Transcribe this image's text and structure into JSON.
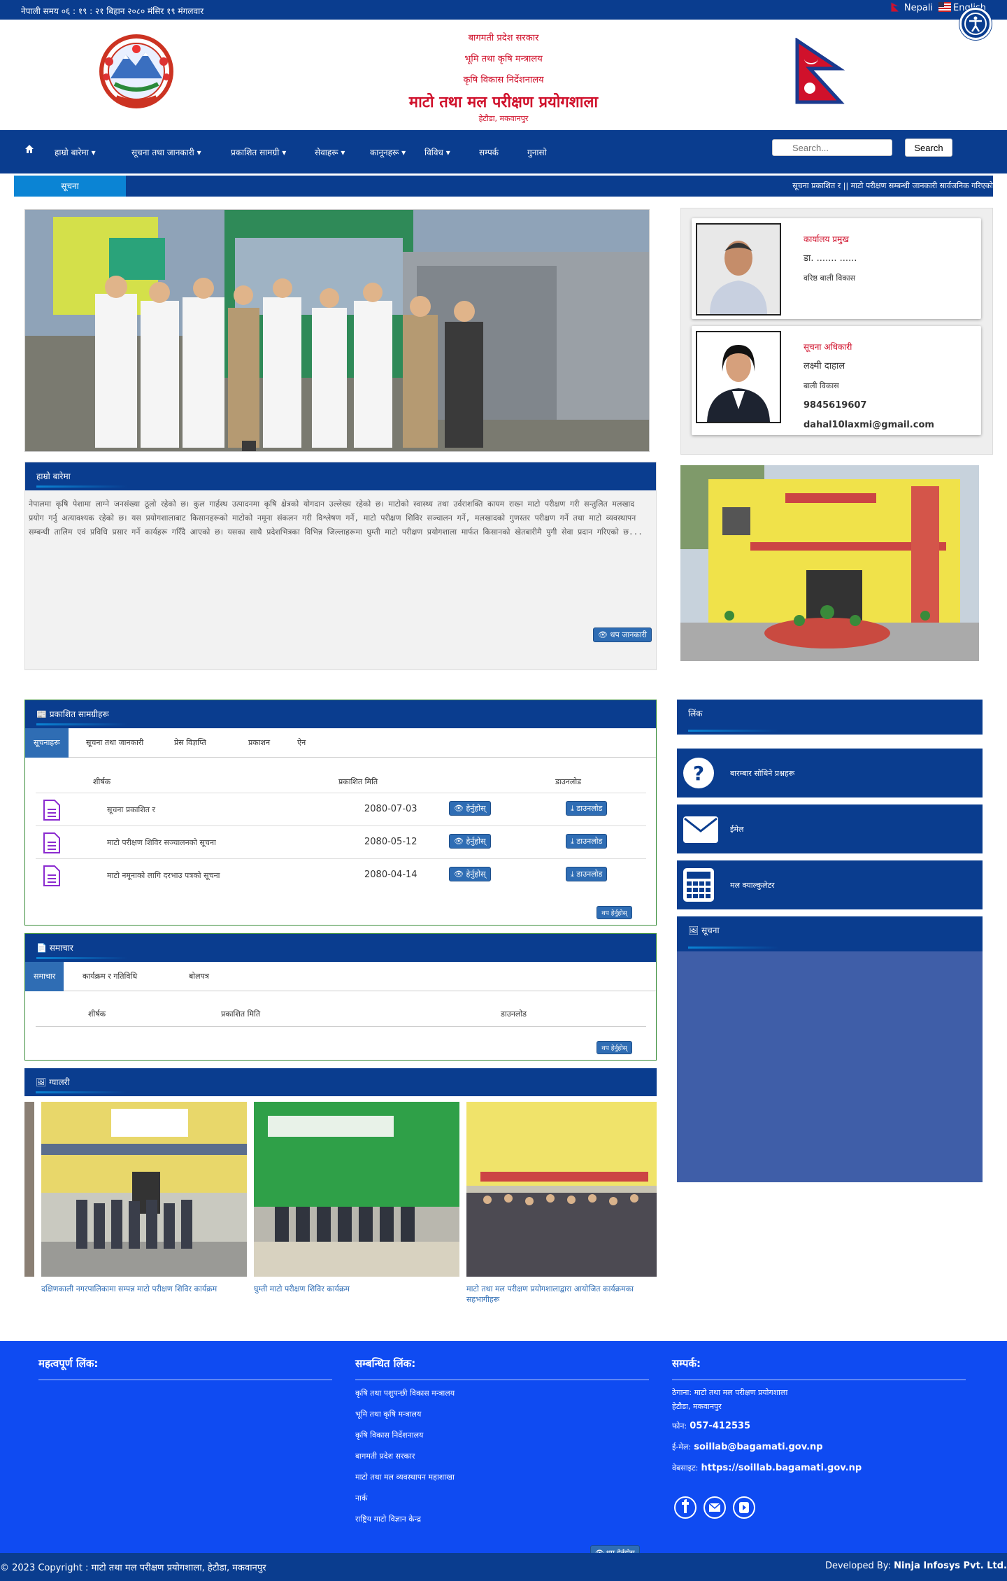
{
  "topbar": {
    "date_time": "नेपाली समय ०६ : १९ : २१ बिहान    २०८० मंसिर १९ मंगलवार",
    "lang_nepali": "Nepali",
    "lang_english": "English"
  },
  "header": {
    "line1": "बागमती प्रदेश सरकार",
    "line2": "भूमि तथा कृषि मन्त्रालय",
    "line3": "कृषि विकास निर्देशनालय",
    "title": "माटो तथा मल परीक्षण प्रयोगशाला",
    "subtitle": "हेटौडा, मकवानपुर"
  },
  "nav": {
    "items": [
      "हाम्रो बारेमा",
      "सूचना तथा जानकारी",
      "प्रकाशित सामग्री",
      "सेवाहरू",
      "कानूनहरू",
      "विविध",
      "सम्पर्क",
      "गुनासो"
    ],
    "search_placeholder": "Search...",
    "search_button": "Search"
  },
  "ticker": {
    "label": "सूचना",
    "message": "सूचना प्रकाशित र   || माटो परीक्षण सम्बन्धी जानकारी सार्वजनिक गरिएको"
  },
  "about": {
    "title": "हाम्रो बारेमा",
    "text": "नेपालमा कृषि पेशामा लाग्ने जनसंख्या ठूलो रहेको छ। कुल गार्हस्थ उत्पादनमा कृषि क्षेत्रको योगदान उल्लेख्य रहेको छ। माटोको स्वास्थ्य तथा उर्वराशक्ति कायम राख्न माटो परीक्षण गरी सन्तुलित मलखाद प्रयोग गर्नु अत्यावश्यक रहेको छ। यस प्रयोगशालाबाट किसानहरूको माटोको नमूना संकलन गरी विश्लेषण गर्ने, माटो परीक्षण शिविर सञ्चालन गर्ने, मलखादको गुणस्तर परीक्षण गर्ने तथा माटो व्यवस्थापन सम्बन्धी तालिम एवं प्रविधि प्रसार गर्ने कार्यहरू गरिँदै आएको छ। यसका साथै प्रदेशभित्रका विभिन्न जिल्लाहरूमा घुम्ती माटो परीक्षण प्रयोगशाला मार्फत किसानको खेतबारीमै पुगी सेवा प्रदान गरिएको छ...",
    "more": "थप जानकारी"
  },
  "officials": [
    {
      "role": "कार्यालय प्रमुख",
      "name": "डा. ....... ......",
      "position": "वरिष्ठ बाली विकास"
    },
    {
      "role": "सूचना अधिकारी",
      "name": "लक्ष्मी दाहाल",
      "position": "बाली विकास",
      "phone": "9845619607",
      "email": "dahal10laxmi@gmail.com"
    }
  ],
  "publications": {
    "title": "प्रकाशित सामग्रीहरू",
    "tabs": [
      "सूचनाहरू",
      "सूचना तथा जानकारी",
      "प्रेस विज्ञप्ति",
      "प्रकाशन",
      "ऐन"
    ],
    "headers": [
      "शीर्षक",
      "प्रकाशित मिति",
      "डाउनलोड"
    ],
    "rows": [
      {
        "title": "सूचना प्रकाशित र",
        "date": "2080-07-03"
      },
      {
        "title": "माटो परीक्षण शिविर सञ्चालनको सूचना",
        "date": "2080-05-12"
      },
      {
        "title": "माटो नमूनाको लागि दरभाउ पत्रको सूचना",
        "date": "2080-04-14"
      }
    ],
    "view_label": "हेर्नुहोस्",
    "download_label": "डाउनलोड",
    "more_label": "थप हेर्नुहोस्"
  },
  "news": {
    "title": "समाचार",
    "tabs": [
      "समाचार",
      "कार्यक्रम र गतिविधि",
      "बोलपत्र"
    ],
    "headers": [
      "शीर्षक",
      "प्रकाशित मिति",
      "डाउनलोड"
    ],
    "more_label": "थप हेर्नुहोस्"
  },
  "gallery": {
    "title": "ग्यालरी",
    "captions": [
      "दक्षिणकाली नगरपालिकामा सम्पन्न माटो परीक्षण शिविर कार्यक्रम",
      "घुम्ती माटो परीक्षण शिविर कार्यक्रम",
      "माटो तथा मल परीक्षण प्रयोगशालाद्वारा आयोजित कार्यक्रमका सहभागीहरू"
    ]
  },
  "links": {
    "title": "लिंक",
    "items": [
      "बारम्बार सोधिने प्रश्नहरू",
      "ईमेल",
      "मल क्याल्कुलेटर"
    ],
    "notice_title": "सूचना"
  },
  "footer": {
    "col1_title": "महत्वपूर्ण लिंक:",
    "col2_title": "सम्बन्धित लिंक:",
    "col3_title": "सम्पर्क:",
    "links": [
      "कृषि तथा पशुपन्छी विकास मन्त्रालय",
      "भूमि तथा कृषि मन्त्रालय",
      "कृषि विकास निर्देशनालय",
      "बागमती प्रदेश सरकार",
      "माटो तथा मल व्यवस्थापन महाशाखा",
      "नार्क",
      "राष्ट्रिय माटो विज्ञान केन्द्र"
    ],
    "more_label": "थप हेर्नुहोस्",
    "address_label": "ठेगाना: माटो तथा मल परीक्षण प्रयोगशाला",
    "address_city": "हेटौडा, मकवानपुर",
    "phone_label": "फोन:",
    "phone": "057-412535",
    "email_label": "ई-मेल:",
    "email": "soillab@bagamati.gov.np",
    "web_label": "वेबसाइट:",
    "web": "https://soillab.bagamati.gov.np"
  },
  "bottom": {
    "copyright": "© 2023 Copyright : माटो तथा मल परीक्षण प्रयोगशाला, हेटौडा, मकवानपुर",
    "dev_label": "Developed By:",
    "dev_name": "Ninja Infosys Pvt. Ltd."
  },
  "colors": {
    "primary": "#0a3d8f",
    "accent": "#0b84d4",
    "footer": "#0f4bf2",
    "title_red": "#d0112b"
  }
}
